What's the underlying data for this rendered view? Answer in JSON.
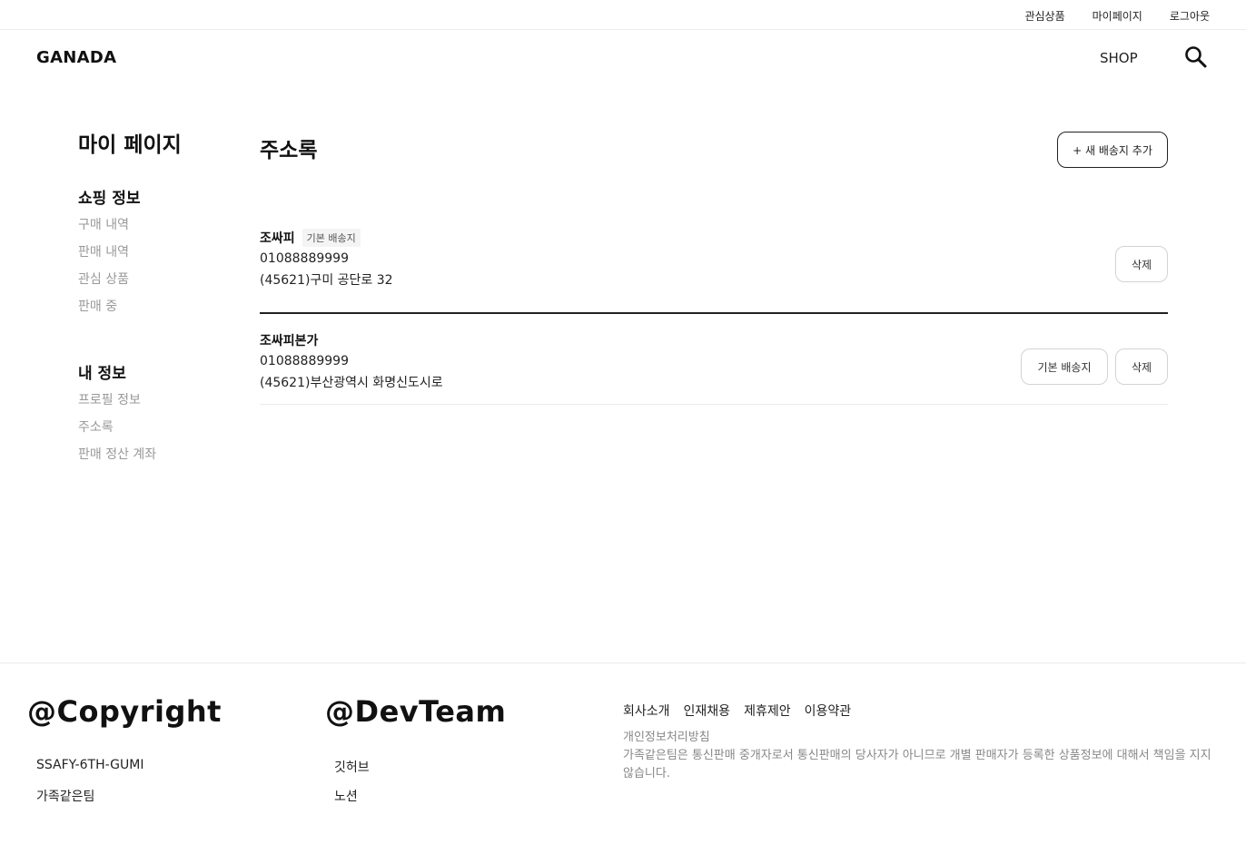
{
  "topbar": {
    "links": [
      "관심상품",
      "마이페이지",
      "로그아웃"
    ]
  },
  "header": {
    "logo": "GANADA",
    "shop_label": "SHOP",
    "search_icon": "search-icon"
  },
  "sidebar": {
    "title": "마이 페이지",
    "groups": [
      {
        "title": "쇼핑 정보",
        "items": [
          "구매 내역",
          "판매 내역",
          "관심 상품",
          "판매 중"
        ]
      },
      {
        "title": "내 정보",
        "items": [
          "프로필 정보",
          "주소록",
          "판매 정산 계좌"
        ]
      }
    ]
  },
  "main": {
    "title": "주소록",
    "add_button": "+ 새 배송지 추가",
    "addresses": [
      {
        "name": "조싸피",
        "badge": "기본 배송지",
        "phone": "01088889999",
        "address": "(45621)구미 공단로 32",
        "delete_label": "삭제"
      },
      {
        "name": "조싸피본가",
        "phone": "01088889999",
        "address": "(45621)부산광역시 화명신도시로",
        "default_label": "기본 배송지",
        "delete_label": "삭제"
      }
    ]
  },
  "footer": {
    "copyright": {
      "title": "@Copyright",
      "items": [
        "SSAFY-6TH-GUMI",
        "가족같은팀"
      ]
    },
    "devteam": {
      "title": "@DevTeam",
      "items": [
        "깃허브",
        "노션"
      ]
    },
    "nav": [
      "회사소개",
      "인재채용",
      "제휴제안",
      "이용약관"
    ],
    "policy": "개인정보처리방침",
    "description": "가족같은팀은 통신판매 중개자로서 통신판매의 당사자가 아니므로 개별 판매자가 등록한 상품정보에 대해서 책임을 지지 않습니다."
  }
}
